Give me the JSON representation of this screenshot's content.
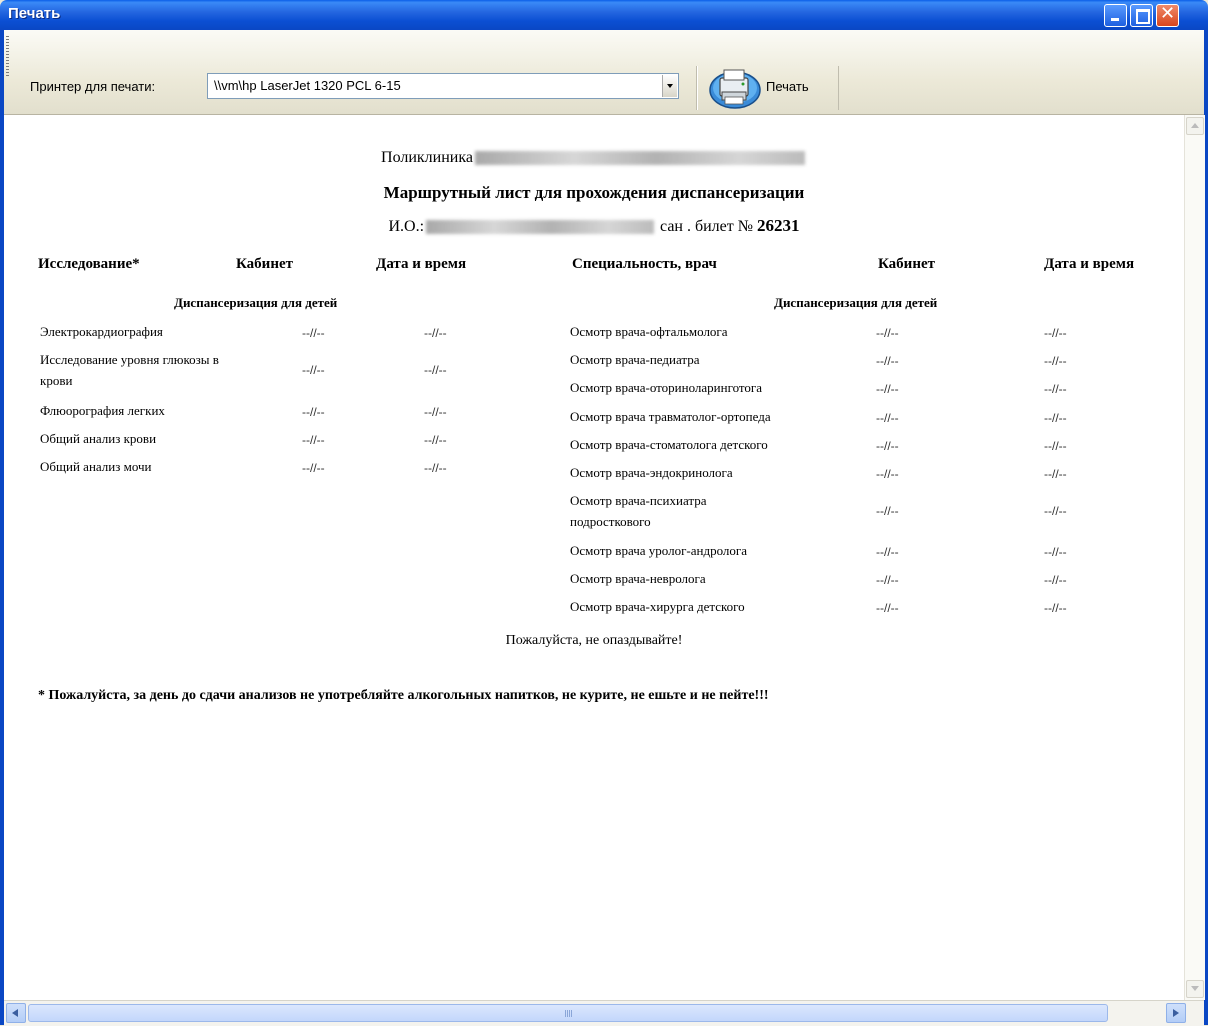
{
  "window": {
    "title": "Печать"
  },
  "toolbar": {
    "printer_label": "Принтер для печати:",
    "printer_value": "\\\\vm\\hp LaserJet 1320 PCL 6-15",
    "print_label": "Печать"
  },
  "document": {
    "clinic_label": "Поликлиника",
    "title": "Маршрутный лист для прохождения диспансеризации",
    "patient_prefix": "И.О.:",
    "ticket_label": "сан . билет №",
    "ticket_no": "26231",
    "left_headers": [
      "Исследование*",
      "Кабинет",
      "Дата и время"
    ],
    "right_headers": [
      "Специальность, врач",
      "Кабинет",
      "Дата и время"
    ],
    "section_left": "Диспансеризация для детей",
    "section_right": "Диспансеризация для детей",
    "empty_value": "--//--",
    "left_rows": [
      {
        "name": "Электрокардиография"
      },
      {
        "name": "Исследование уровня глюкозы в",
        "name2": "крови"
      },
      {
        "name": "Флюорография легких"
      },
      {
        "name": "Общий анализ крови"
      },
      {
        "name": "Общий анализ мочи"
      }
    ],
    "right_rows": [
      {
        "name": "Осмотр врача-офтальмолога"
      },
      {
        "name": "Осмотр врача-педиатра"
      },
      {
        "name": "Осмотр врача-оториноларинготога"
      },
      {
        "name": "Осмотр врача травматолог-ортопеда"
      },
      {
        "name": "Осмотр врача-стоматолога детского"
      },
      {
        "name": "Осмотр врача-эндокринолога"
      },
      {
        "name": "Осмотр врача-психиатра",
        "name2": "подросткового"
      },
      {
        "name": "Осмотр врача уролог-андролога"
      },
      {
        "name": "Осмотр врача-невролога"
      },
      {
        "name": "Осмотр врача-хирурга детского"
      }
    ],
    "please": "Пожалуйста, не опаздывайте!",
    "note": "* Пожалуйста, за день до сдачи анализов не употребляйте алкогольных напитков, не курите, не ешьте и не пейте!!!"
  }
}
